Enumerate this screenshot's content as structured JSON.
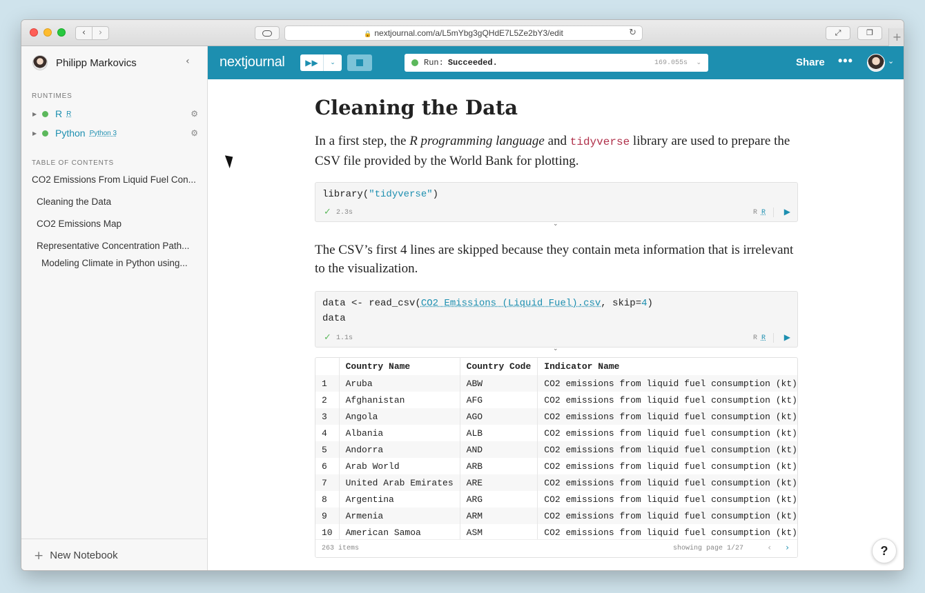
{
  "browser": {
    "url": "nextjournal.com/a/L5mYbg3gQHdE7L5Ze2bY3/edit"
  },
  "sidebar": {
    "username": "Philipp Markovics",
    "runtimes_label": "RUNTIMES",
    "runtimes": [
      {
        "name": "R",
        "badge": "R"
      },
      {
        "name": "Python",
        "badge": "Python 3"
      }
    ],
    "toc_label": "TABLE OF CONTENTS",
    "toc": [
      "CO2 Emissions From Liquid Fuel Con...",
      "Cleaning the Data",
      "CO2 Emissions Map",
      "Representative Concentration Path...",
      "Modeling Climate in Python using..."
    ],
    "new_notebook": "New Notebook"
  },
  "appbar": {
    "logo": "nextjournal",
    "run_label": "Run:",
    "run_status": "Succeeded.",
    "run_time": "169.055s",
    "share": "Share",
    "status_color": "#5cb85c",
    "brand_color": "#1d8fb0"
  },
  "doc": {
    "title": "Cleaning the Data",
    "para1": {
      "a": "In a first step, the ",
      "em": "R programming language",
      "b": " and ",
      "code": "tidyverse",
      "c": " library are used to prepare the CSV file provided by the World Bank for plotting."
    },
    "cell1": {
      "fn": "library(",
      "arg": "\"tidyverse\"",
      "close": ")",
      "duration": "2.3s",
      "lang": "R",
      "runtime": "R"
    },
    "para2": "The CSV’s first 4 lines are skipped because they contain meta information that is irrelevant to the visualization.",
    "cell2": {
      "line1_a": "data <- read_csv(",
      "line1_link": "CO2 Emissions (Liquid Fuel).csv",
      "line1_b": ", skip=",
      "line1_num": "4",
      "line1_c": ")",
      "line2": "data",
      "duration": "1.1s",
      "lang": "R",
      "runtime": "R"
    },
    "table": {
      "headers": [
        "",
        "Country Name",
        "Country Code",
        "Indicator Name"
      ],
      "rows": [
        [
          "1",
          "Aruba",
          "ABW",
          "CO2 emissions from liquid fuel consumption (kt)"
        ],
        [
          "2",
          "Afghanistan",
          "AFG",
          "CO2 emissions from liquid fuel consumption (kt)"
        ],
        [
          "3",
          "Angola",
          "AGO",
          "CO2 emissions from liquid fuel consumption (kt)"
        ],
        [
          "4",
          "Albania",
          "ALB",
          "CO2 emissions from liquid fuel consumption (kt)"
        ],
        [
          "5",
          "Andorra",
          "AND",
          "CO2 emissions from liquid fuel consumption (kt)"
        ],
        [
          "6",
          "Arab World",
          "ARB",
          "CO2 emissions from liquid fuel consumption (kt)"
        ],
        [
          "7",
          "United Arab Emirates",
          "ARE",
          "CO2 emissions from liquid fuel consumption (kt)"
        ],
        [
          "8",
          "Argentina",
          "ARG",
          "CO2 emissions from liquid fuel consumption (kt)"
        ],
        [
          "9",
          "Armenia",
          "ARM",
          "CO2 emissions from liquid fuel consumption (kt)"
        ],
        [
          "10",
          "American Samoa",
          "ASM",
          "CO2 emissions from liquid fuel consumption (kt)"
        ]
      ],
      "items": "263 items",
      "page": "showing page 1/27"
    }
  },
  "help": "?"
}
